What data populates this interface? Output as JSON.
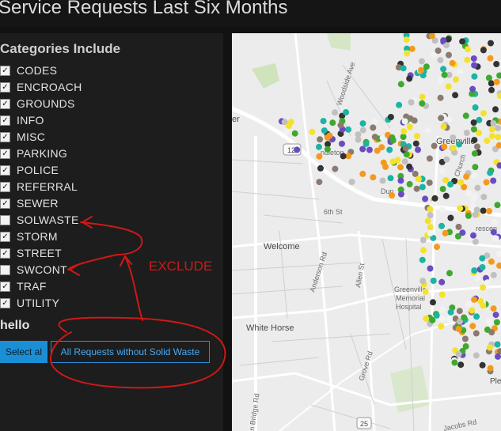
{
  "page": {
    "title": "Service Requests Last Six Months"
  },
  "sidebar": {
    "heading": "Categories Include",
    "categories": [
      {
        "label": "CODES",
        "checked": true
      },
      {
        "label": "ENCROACH",
        "checked": true
      },
      {
        "label": "GROUNDS",
        "checked": true
      },
      {
        "label": "INFO",
        "checked": true
      },
      {
        "label": "MISC",
        "checked": true
      },
      {
        "label": "PARKING",
        "checked": true
      },
      {
        "label": "POLICE",
        "checked": true
      },
      {
        "label": "REFERRAL",
        "checked": true
      },
      {
        "label": "SEWER",
        "checked": true
      },
      {
        "label": "SOLWASTE",
        "checked": false
      },
      {
        "label": "STORM",
        "checked": true
      },
      {
        "label": "STREET",
        "checked": true
      },
      {
        "label": "SWCONT",
        "checked": false
      },
      {
        "label": "TRAF",
        "checked": true
      },
      {
        "label": "UTILITY",
        "checked": true
      }
    ],
    "group_title": "hello",
    "select_all_label": "Select al",
    "all_requests_label": "All Requests without Solid Waste"
  },
  "annotation": {
    "text": "EXCLUDE",
    "color": "#d01818"
  },
  "map": {
    "labels": {
      "woodside": "Woodside Ave",
      "greenville": "Greenville",
      "welcome": "Welcome",
      "white_horse": "White Horse",
      "sixth": "6th St",
      "anderson": "Anderson Rd",
      "allen": "Allen St",
      "hospital": "Greenville\nMemorial\nHospital",
      "grove": "Grove Rd",
      "pleasant": "Plea",
      "jacobs": "Jacobs Rd",
      "bridge": "n Bridge Rd",
      "dun": "Dun",
      "church": "S Church",
      "crescent": "rescen",
      "er": "er",
      "pendleton": "ndleton",
      "route_124": "124",
      "route_25": "25"
    },
    "dot_colors": [
      "#f39a1e",
      "#f5e12c",
      "#3ea92e",
      "#333333",
      "#1db3a3",
      "#8a7a70",
      "#f2f2f2",
      "#c0c0c0",
      "#6a4cc2"
    ]
  }
}
